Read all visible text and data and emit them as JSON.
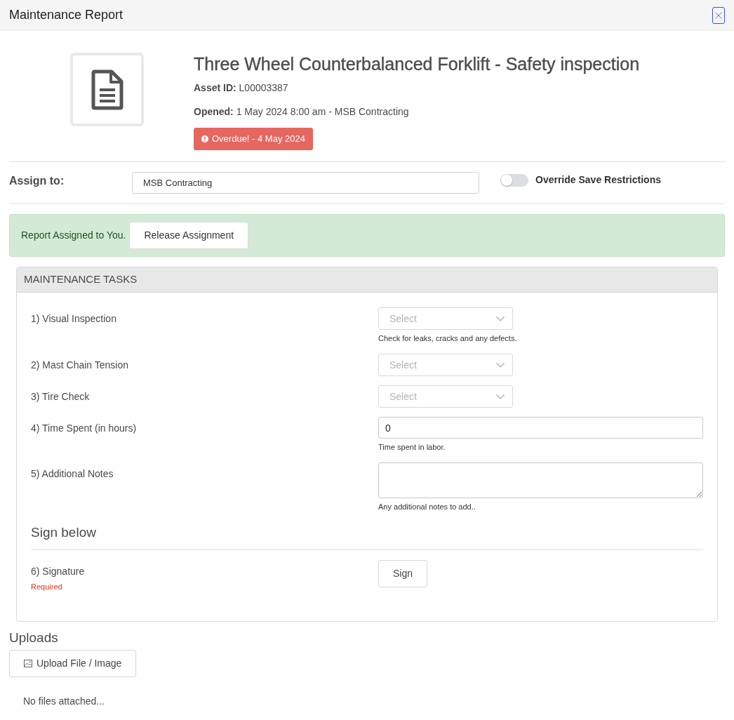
{
  "dialog": {
    "title": "Maintenance Report"
  },
  "report": {
    "title": "Three Wheel Counterbalanced Forklift - Safety inspection",
    "asset_id": {
      "label": "Asset ID:",
      "value": "L00003387"
    },
    "opened": {
      "label": "Opened:",
      "value": "1 May 2024 8:00 am - MSB Contracting"
    },
    "overdue_badge": "Overdue! - 4 May 2024"
  },
  "assign": {
    "label": "Assign to:",
    "value": "MSB Contracting"
  },
  "override": {
    "label": "Override Save Restrictions",
    "on": false
  },
  "assignment_alert": {
    "message": "Report Assigned to You.",
    "button": "Release Assignment"
  },
  "tasks": {
    "heading": "MAINTENANCE TASKS",
    "items": [
      {
        "kind": "select",
        "label": "1) Visual Inspection",
        "placeholder": "Select",
        "help": "Check for leaks, cracks and any defects."
      },
      {
        "kind": "select",
        "label": "2) Mast Chain Tension",
        "placeholder": "Select"
      },
      {
        "kind": "select",
        "label": "3) Tire Check",
        "placeholder": "Select"
      },
      {
        "kind": "number",
        "label": "4) Time Spent (in hours)",
        "value": "0",
        "help": "Time spent in labor."
      },
      {
        "kind": "textarea",
        "label": "5) Additional Notes",
        "help": "Any additional notes to add.."
      }
    ],
    "sign_section": {
      "heading": "Sign below",
      "items": [
        {
          "kind": "signature",
          "label": "6) Signature",
          "required_note": "Required",
          "button": "Sign"
        }
      ]
    }
  },
  "uploads": {
    "heading": "Uploads",
    "button": "Upload File / Image",
    "empty_message": "No files attached..."
  }
}
